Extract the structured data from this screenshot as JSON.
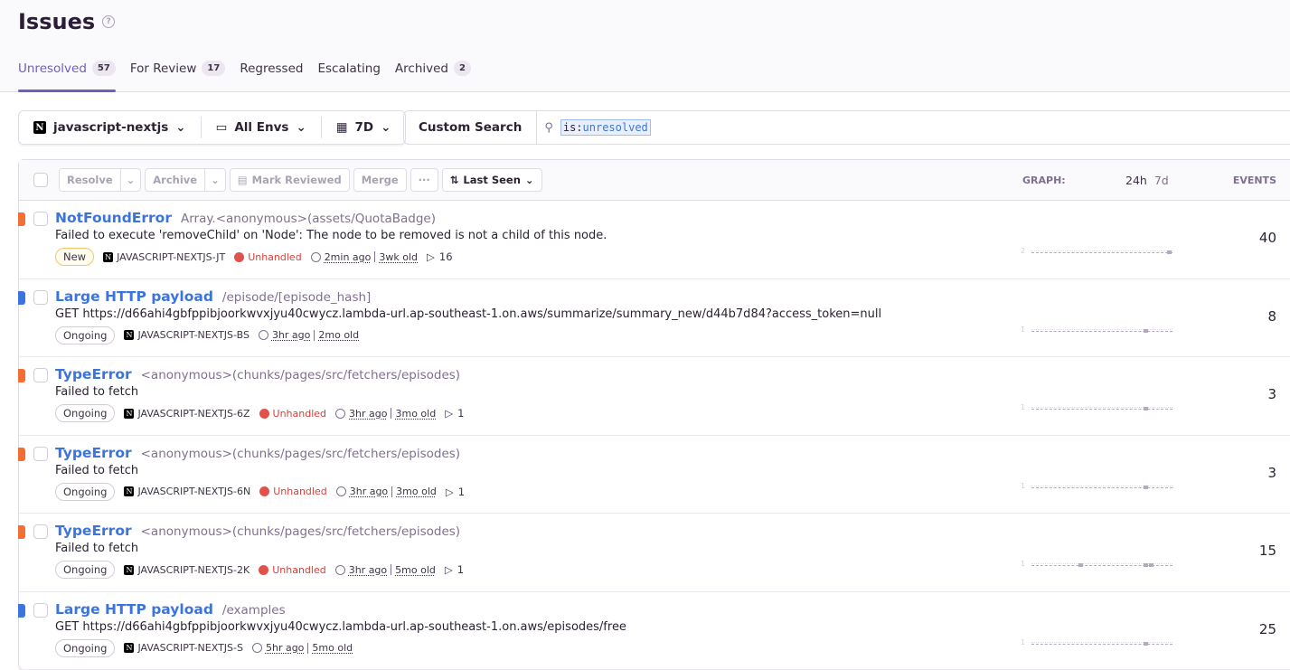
{
  "header": {
    "title": "Issues"
  },
  "tabs": [
    {
      "label": "Unresolved",
      "count": "57"
    },
    {
      "label": "For Review",
      "count": "17"
    },
    {
      "label": "Regressed"
    },
    {
      "label": "Escalating"
    },
    {
      "label": "Archived",
      "count": "2"
    }
  ],
  "filters": {
    "project": "javascript-nextjs",
    "env": "All Envs",
    "period": "7D"
  },
  "search": {
    "custom_label": "Custom Search",
    "token_key": "is:",
    "token_value": "unresolved"
  },
  "toolbar": {
    "resolve": "Resolve",
    "archive": "Archive",
    "mark_reviewed": "Mark Reviewed",
    "merge": "Merge",
    "more": "···",
    "sort": "Last Seen",
    "graph": "GRAPH:",
    "range_24h": "24h",
    "range_7d": "7d",
    "events": "EVENTS"
  },
  "colors": {
    "error": "#f36e32",
    "info": "#3c74dd",
    "accent": "#6c5fc7"
  },
  "issues": [
    {
      "level": "error",
      "title": "NotFoundError",
      "location": "Array.<anonymous>(assets/QuotaBadge)",
      "message": "Failed to execute 'removeChild' on 'Node': The node to be removed is not a child of this node.",
      "status": "New",
      "short_id": "JAVASCRIPT-NEXTJS-JT",
      "handled": "Unhandled",
      "last_seen": "2min ago",
      "age": "3wk old",
      "replays": "16",
      "graph_max": "2",
      "graph": [
        0,
        0,
        0,
        0,
        0,
        0,
        0,
        0,
        0,
        0,
        0,
        0,
        0,
        0,
        0,
        0,
        0,
        0,
        0,
        0,
        0,
        0,
        0,
        2
      ],
      "events": "40"
    },
    {
      "level": "info",
      "title": "Large HTTP payload",
      "location": "/episode/[episode_hash]",
      "message": "GET https://d66ahi4gbfppibjoorkwvxjyu40cwycz.lambda-url.ap-southeast-1.on.aws/summarize/summary_new/d44b7d84?access_token=null",
      "status": "Ongoing",
      "short_id": "JAVASCRIPT-NEXTJS-BS",
      "last_seen": "3hr ago",
      "age": "2mo old",
      "graph_max": "1",
      "graph": [
        0,
        0,
        0,
        0,
        0,
        0,
        0,
        0,
        0,
        0,
        0,
        0,
        0,
        0,
        0,
        0,
        0,
        0,
        0,
        1,
        0,
        0,
        0,
        0
      ],
      "events": "8"
    },
    {
      "level": "error",
      "title": "TypeError",
      "location": "<anonymous>(chunks/pages/src/fetchers/episodes)",
      "message": "Failed to fetch",
      "status": "Ongoing",
      "short_id": "JAVASCRIPT-NEXTJS-6Z",
      "handled": "Unhandled",
      "last_seen": "3hr ago",
      "age": "3mo old",
      "replays": "1",
      "graph_max": "1",
      "graph": [
        0,
        0,
        0,
        0,
        0,
        0,
        0,
        0,
        0,
        0,
        0,
        0,
        0,
        0,
        0,
        0,
        0,
        0,
        0,
        1,
        0,
        0,
        0,
        0
      ],
      "events": "3"
    },
    {
      "level": "error",
      "title": "TypeError",
      "location": "<anonymous>(chunks/pages/src/fetchers/episodes)",
      "message": "Failed to fetch",
      "status": "Ongoing",
      "short_id": "JAVASCRIPT-NEXTJS-6N",
      "handled": "Unhandled",
      "last_seen": "3hr ago",
      "age": "3mo old",
      "replays": "1",
      "graph_max": "1",
      "graph": [
        0,
        0,
        0,
        0,
        0,
        0,
        0,
        0,
        0,
        0,
        0,
        0,
        0,
        0,
        0,
        0,
        0,
        0,
        0,
        1,
        0,
        0,
        0,
        0
      ],
      "events": "3"
    },
    {
      "level": "error",
      "title": "TypeError",
      "location": "<anonymous>(chunks/pages/src/fetchers/episodes)",
      "message": "Failed to fetch",
      "status": "Ongoing",
      "short_id": "JAVASCRIPT-NEXTJS-2K",
      "handled": "Unhandled",
      "last_seen": "3hr ago",
      "age": "5mo old",
      "replays": "1",
      "graph_max": "1",
      "graph": [
        0,
        0,
        0,
        0,
        0,
        0,
        0,
        0,
        1,
        0,
        0,
        0,
        0,
        0,
        0,
        0,
        0,
        0,
        0,
        1,
        1,
        0,
        0,
        0
      ],
      "events": "15"
    },
    {
      "level": "info",
      "title": "Large HTTP payload",
      "location": "/examples",
      "message": "GET https://d66ahi4gbfppibjoorkwvxjyu40cwycz.lambda-url.ap-southeast-1.on.aws/episodes/free",
      "status": "Ongoing",
      "short_id": "JAVASCRIPT-NEXTJS-S",
      "last_seen": "5hr ago",
      "age": "5mo old",
      "graph_max": "1",
      "graph": [
        0,
        0,
        0,
        0,
        0,
        0,
        0,
        0,
        0,
        0,
        0,
        0,
        0,
        0,
        0,
        0,
        0,
        0,
        0,
        1,
        0,
        0,
        0,
        0
      ],
      "events": "25"
    }
  ]
}
